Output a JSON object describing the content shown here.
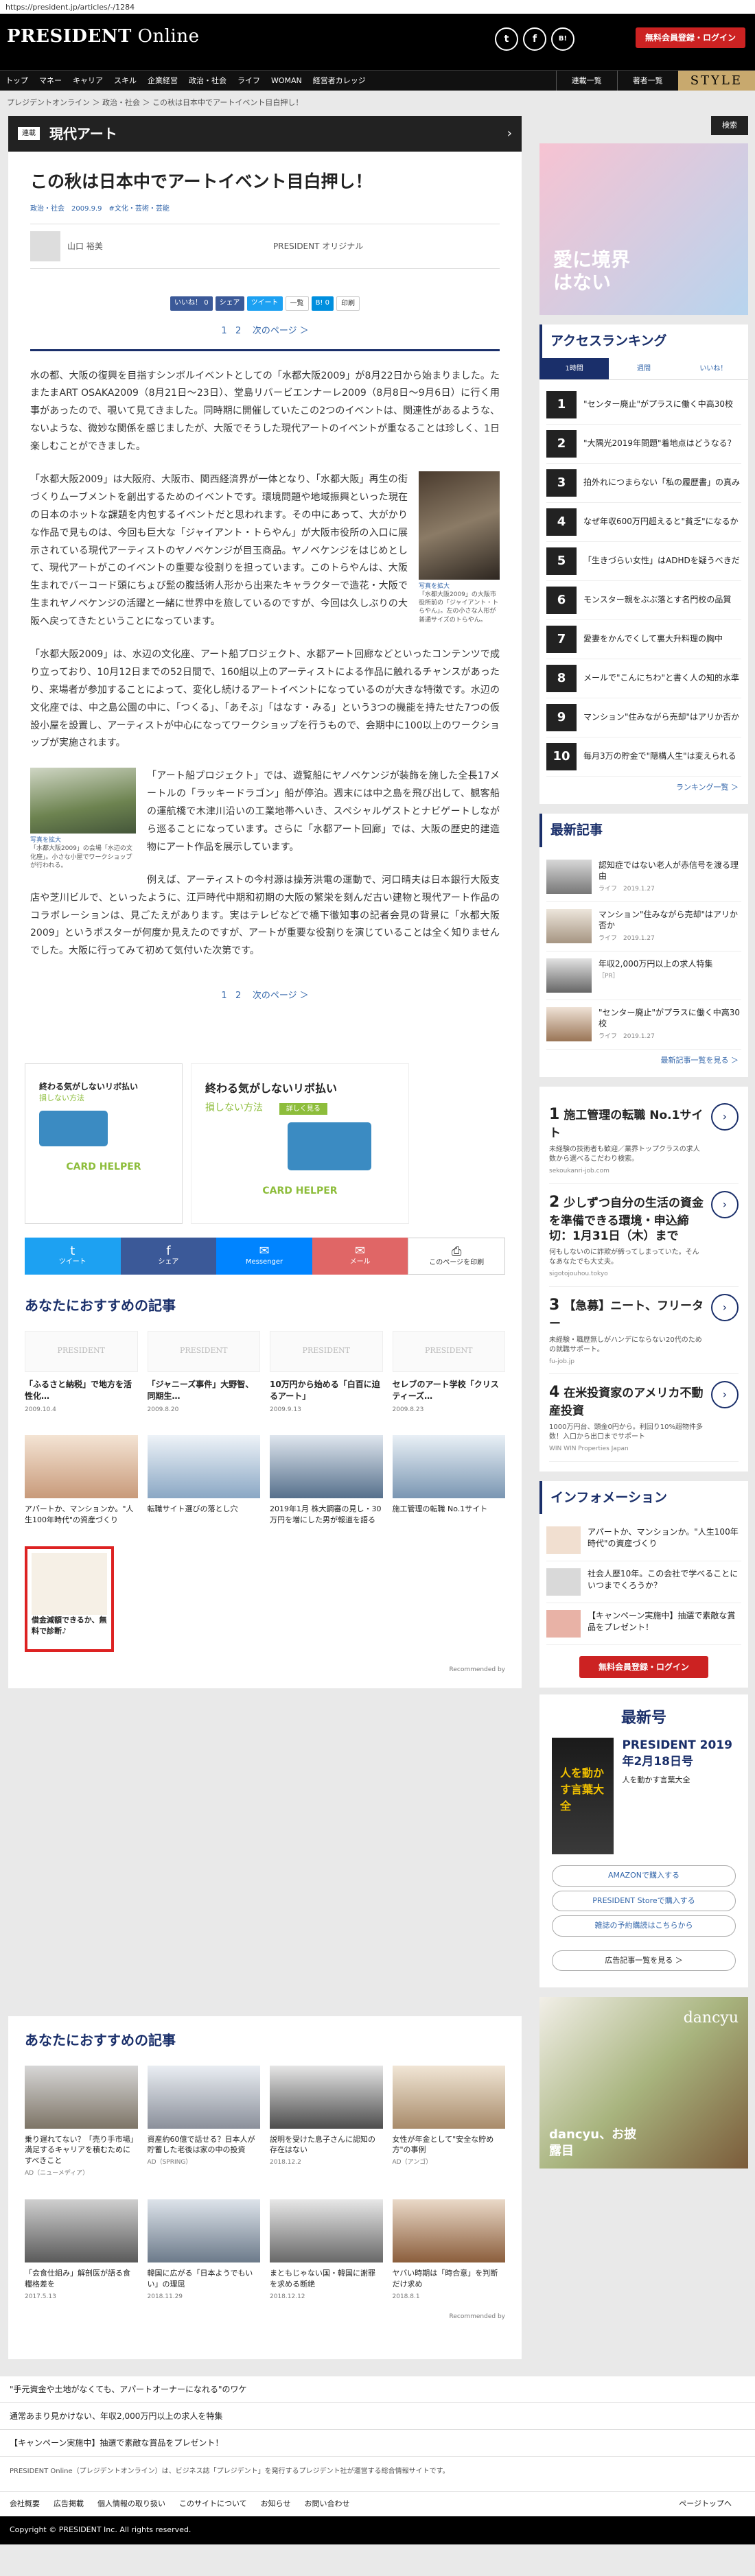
{
  "url": "https://president.jp/articles/-/1284",
  "header": {
    "logo_a": "PRESIDENT",
    "logo_b": " Online",
    "register": "無料会員登録・ログイン",
    "social": [
      "t",
      "f",
      "B!"
    ]
  },
  "nav": {
    "items": [
      "トップ",
      "マネー",
      "キャリア",
      "スキル",
      "企業経営",
      "政治・社会",
      "ライフ",
      "WOMAN",
      "経営者カレッジ"
    ],
    "right": [
      "連載一覧",
      "著者一覧"
    ],
    "style": "STYLE"
  },
  "breadcrumb": "プレジデントオンライン ＞ 政治・社会 ＞ この秋は日本中でアートイベント目白押し！",
  "section": {
    "tag": "連載",
    "title": "現代アート"
  },
  "article": {
    "title": "この秋は日本中でアートイベント目白押し！",
    "meta": "政治・社会　2009.9.9　#文化・芸術・芸能",
    "author": "山口 裕美",
    "org": "PRESIDENT オリジナル",
    "share": [
      "いいね！ 0",
      "シェア",
      "ツイート",
      "一覧",
      "B! 0",
      "印刷"
    ],
    "pager": [
      "1",
      "2",
      "次のページ ＞"
    ],
    "p1": "水の都、大阪の復興を目指すシンボルイベントとしての「水都大阪2009」が8月22日から始まりました。たまたまART OSAKA2009（8月21日〜23日）、堂島リバービエンナーレ2009（8月8日〜9月6日）に行く用事があったので、覗いて見てきました。同時期に開催していたこの2つのイベントは、関連性があるような、ないような、微妙な関係を感じましたが、大阪でそうした現代アートのイベントが重なることは珍しく、1日楽しむことができました。",
    "p2": "「水都大阪2009」は大阪府、大阪市、関西経済界が一体となり、「水都大阪」再生の街づくりムーブメントを創出するためのイベントです。環境問題や地域振興といった現在の日本のホットな課題を内包するイベントだと思われます。その中にあって、大がかりな作品で見ものは、今回も巨大な「ジャイアント・トらやん」が大阪市役所の入口に展示されている現代アーティストのヤノベケンジが目玉商品。ヤノベケンジをはじめとして、現代アートがこのイベントの重要な役割りを担っています。このトらやんは、大阪生まれでバーコード頭にちょび髭の腹話術人形から出来たキャラクターで造花・大阪で生まれヤノベケンジの活躍と一緒に世界中を旅しているのですが、今回は久しぶりの大阪へ戻ってきたということになっています。",
    "p3": "「水都大阪2009」は、水辺の文化座、アート船プロジェクト、水都アート回廊などといったコンテンツで成り立っており、10月12日までの52日間で、160組以上のアーティストによる作品に触れるチャンスがあったり、来場者が参加することによって、変化し続けるアートイベントになっているのが大きな特徴です。水辺の文化座では、中之島公園の中に、「つくる」、「あそぶ」「はなす・みる」という3つの機能を持たせた7つの仮設小屋を設置し、アーティストが中心になってワークショップを行うもので、会期中に100以上のワークショップが実施されます。",
    "p4": "「アート船プロジェクト」では、遊覧船にヤノベケンジが装飾を施した全長17メートルの「ラッキードラゴン」船が停泊。週末には中之島を飛び出して、観客船の運航橋で木津川沿いの工業地帯へいき、スペシャルゲストとナビゲートしながら巡ることになっています。さらに「水都アート回廊」では、大阪の歴史的建造物にアート作品を展示しています。",
    "p5": "例えば、アーティストの今村源は操芳洪電の運動で、河口晴夫は日本銀行大阪支店や芝川ビルで、といったように、江戸時代中期和初期の大阪の繁栄を刻んだ古い建物と現代アート作品のコラボレーションは、見ごたえがあります。実はテレビなどで橋下徹知事の記者会見の背景に「水都大阪2009」というポスターが何度か見えたのですが、アートが重要な役割りを演じていることは全く知りませんでした。大阪に行ってみて初めて気付いた次第です。",
    "cap1": "写真を拡大\n「水都大阪2009」の大阪市役所前の「ジャイアント・トらやん」。左の小さな人形が普通サイズのトらやん。",
    "cap2": "写真を拡大\n「水都大阪2009」の会場「水辺の文化座」。小さな小屋でワークショップが行われる。"
  },
  "ads": {
    "a1_title": "終わる気がしないリボ払い",
    "a1_sub": "損しない方法",
    "a2_title": "終わる気がしないリボ払い",
    "a2_sub": "損しない方法",
    "a2_btn": "詳しく見る",
    "brand": "CARD HELPER"
  },
  "sharebar": [
    "ツイート",
    "シェア",
    "Messenger",
    "メール",
    "このページを印刷"
  ],
  "rec1": {
    "heading": "あなたにおすすめの記事",
    "items": [
      {
        "title": "「ふるさと納税」で地方を活性化…",
        "date": "2009.10.4"
      },
      {
        "title": "「ジャニーズ事件」大野智、同期生…",
        "date": "2009.8.20"
      },
      {
        "title": "10万円から始める「白百に迫るアート」",
        "date": "2009.9.13"
      },
      {
        "title": "セレブのアート学校「クリスティーズ…",
        "date": "2009.8.23"
      }
    ],
    "ads": [
      "アパートか、マンションか。\"人生100年時代\"の資産づくり",
      "転職サイト選びの落とし穴",
      "2019年1月 株大鋼審の見し・30万円を増にした男が報道を語る",
      "施工管理の転職 No.1サイト"
    ],
    "promo": "借金減額できるか、無料で診断♪",
    "credit": "Recommended by"
  },
  "rec2": {
    "heading": "あなたにおすすめの記事",
    "items": [
      {
        "title": "乗り遅れてない？「売り手市場」満足するキャリアを積むためにすべきこと",
        "date": "AD（ニューメディア）"
      },
      {
        "title": "資産約60億で話せる？日本人が貯蓄した老後は家の中の投資",
        "date": "AD（SPRING）"
      },
      {
        "title": "説明を受けた息子さんに認知の存在はない",
        "date": "2018.12.2"
      },
      {
        "title": "女性が年金として\"安全な貯め方\"の事例",
        "date": "AD（アンゴ）"
      },
      {
        "title": "「会食仕組み」解剖医が語る食糧格差を",
        "date": "2017.5.13"
      },
      {
        "title": "韓国に広がる「日本ようでもいい」の理屈",
        "date": "2018.11.29"
      },
      {
        "title": "まともじゃない国・韓国に謝罪を求める断絶",
        "date": "2018.12.12"
      },
      {
        "title": "ヤバい時期は「時合意」を判断だけ求め",
        "date": "2018.8.1"
      }
    ]
  },
  "footer_links": [
    "\"手元資金や土地がなくても、アパートオーナーになれる\"のワケ",
    "通常あまり見かけない、年収2,000万円以上の求人を特集",
    "【キャンペーン実施中】抽選で素敵な賞品をプレゼント！"
  ],
  "footer_desc": "PRESIDENT Online（プレジデントオンライン）は、ビジネス誌「プレジデント」を発行するプレジデント社が運営する総合情報サイトです。",
  "footer_nav": [
    "会社概要",
    "広告掲載",
    "個人情報の取り扱い",
    "このサイトについて",
    "お知らせ",
    "お問い合わせ"
  ],
  "pagetop": "ページトップへ",
  "copyright": "Copyright © PRESIDENT Inc. All rights reserved.",
  "sidebar": {
    "search": "検索",
    "banner_text": "愛に境界はない",
    "ranking_heading": "アクセスランキング",
    "tabs": [
      "1時間",
      "週間",
      "いいね！"
    ],
    "ranking": [
      "\"センター廃止\"がプラスに働く中高30校",
      "\"大隅光2019年問題\"着地点はどうなる？",
      "拍外れにつまらない「私の履歴書」の真み",
      "なぜ年収600万円超えると\"貧乏\"になるか",
      "「生きづらい女性」はADHDを疑うべきだ",
      "モンスター親をぶぶ落とす名門校の品質",
      "愛妻をかんでくして裏大升料理の胸中",
      "メールで\"こんにちわ\"と書く人の知的水準",
      "マンション\"住みながら売却\"はアリか否か",
      "毎月3万の貯金で\"隠構人生\"は変えられる"
    ],
    "ranking_more": "ランキング一覧 ＞",
    "latest_heading": "最新記事",
    "latest": [
      {
        "t": "認知症ではない老人が赤信号を渡る理由",
        "c": "ライフ　2019.1.27"
      },
      {
        "t": "マンション\"住みながら売却\"はアリか否か",
        "c": "ライフ　2019.1.27"
      },
      {
        "t": "年収2,000万円以上の求人特集",
        "c": "［PR］"
      },
      {
        "t": "\"センター廃止\"がプラスに働く中高30校",
        "c": "ライフ　2019.1.27"
      }
    ],
    "latest_more": "最新記事一覧を見る ＞",
    "sads": [
      {
        "n": "1",
        "t": "施工管理の転職 No.1サイト",
        "d": "未経験の技術者も歓迎／業界トップクラスの求人数から選べるこだわり検索。",
        "u": "sekoukanri-job.com"
      },
      {
        "n": "2",
        "t": "少しずつ自分の生活の資金を準備できる環境・申込締切：1月31日（木）まで",
        "d": "何もしないのに詐欺が締ってしまっていた。そんなあなたでも大丈夫。",
        "u": "sigotojouhou.tokyo"
      },
      {
        "n": "3",
        "t": "【急募】ニート、フリーター",
        "d": "未経験・職歴無しがハンデにならない20代のための就職サポート。",
        "u": "fu-job.jp"
      },
      {
        "n": "4",
        "t": "在米投資家のアメリカ不動産投資",
        "d": "1000万円台、頭金0円から。利回り10%超物件多数！入口から出口までサポート",
        "u": "WIN WIN Properties Japan"
      }
    ],
    "info_heading": "インフォメーション",
    "info": [
      "アパートか、マンションか。\"人生100年時代\"の資産づくり",
      "社会人歴10年。この会社で学べることにいつまでくろうか？",
      "【キャンペーン実施中】抽選で素敵な賞品をプレゼント！"
    ],
    "reg": "無料会員登録・ログイン",
    "mag_heading": "最新号",
    "mag_title": "PRESIDENT 2019年2月18日号",
    "mag_sub": "人を動かす言葉大全",
    "mag_cover": "人を動かす言葉大全",
    "mag_btns": [
      "AMAZONで購入する",
      "PRESIDENT Storeで購入する",
      "雑誌の予約購読はこちらから"
    ],
    "ad_more": "広告記事一覧を見る ＞",
    "dancyu": "dancyu",
    "dancyu_sub": "dancyu、お披露目"
  }
}
